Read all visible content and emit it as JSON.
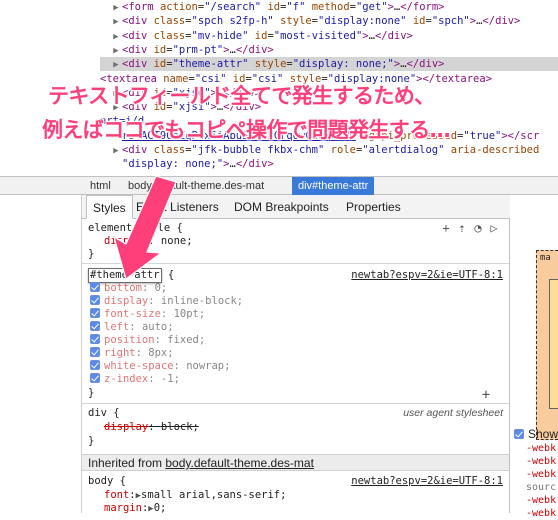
{
  "dom_tree": [
    {
      "parts": [
        [
          "tri",
          "▶"
        ],
        [
          "tag",
          "<form "
        ],
        [
          "attr",
          "action"
        ],
        [
          "txt",
          "="
        ],
        [
          "val",
          "\"/search\""
        ],
        [
          "txt",
          " "
        ],
        [
          "attr",
          "id"
        ],
        [
          "txt",
          "="
        ],
        [
          "val",
          "\"f\""
        ],
        [
          "txt",
          " "
        ],
        [
          "attr",
          "method"
        ],
        [
          "txt",
          "="
        ],
        [
          "val",
          "\"get\""
        ],
        [
          "tag",
          ">"
        ],
        [
          "txt",
          "…"
        ],
        [
          "tag",
          "</form>"
        ]
      ]
    },
    {
      "parts": [
        [
          "tri",
          "▶"
        ],
        [
          "tag",
          "<div "
        ],
        [
          "attr",
          "class"
        ],
        [
          "txt",
          "="
        ],
        [
          "val",
          "\"spch s2fp-h\""
        ],
        [
          "txt",
          " "
        ],
        [
          "attr",
          "style"
        ],
        [
          "txt",
          "="
        ],
        [
          "val",
          "\"display:none\""
        ],
        [
          "txt",
          " "
        ],
        [
          "attr",
          "id"
        ],
        [
          "txt",
          "="
        ],
        [
          "val",
          "\"spch\""
        ],
        [
          "tag",
          ">"
        ],
        [
          "txt",
          "…"
        ],
        [
          "tag",
          "</div>"
        ]
      ]
    },
    {
      "parts": [
        [
          "tri",
          "▶"
        ],
        [
          "tag",
          "<div "
        ],
        [
          "attr",
          "class"
        ],
        [
          "txt",
          "="
        ],
        [
          "val",
          "\"mv-hide\""
        ],
        [
          "txt",
          " "
        ],
        [
          "attr",
          "id"
        ],
        [
          "txt",
          "="
        ],
        [
          "val",
          "\"most-visited\""
        ],
        [
          "tag",
          ">"
        ],
        [
          "txt",
          "…"
        ],
        [
          "tag",
          "</div>"
        ]
      ]
    },
    {
      "parts": [
        [
          "tri",
          "▶"
        ],
        [
          "tag",
          "<div "
        ],
        [
          "attr",
          "id"
        ],
        [
          "txt",
          "="
        ],
        [
          "val",
          "\"prm-pt\""
        ],
        [
          "tag",
          ">"
        ],
        [
          "txt",
          "…"
        ],
        [
          "tag",
          "</div>"
        ]
      ]
    },
    {
      "parts": [
        [
          "tri",
          "▶"
        ],
        [
          "tag",
          "<div "
        ],
        [
          "attr",
          "id"
        ],
        [
          "txt",
          "="
        ],
        [
          "val",
          "\"theme-attr\""
        ],
        [
          "txt",
          " "
        ],
        [
          "attr",
          "style"
        ],
        [
          "txt",
          "="
        ],
        [
          "val",
          "\"display: none;\""
        ],
        [
          "tag",
          ">"
        ],
        [
          "txt",
          "…"
        ],
        [
          "tag",
          "</div>"
        ]
      ]
    },
    {
      "parts": [
        [
          "tag",
          "<textarea "
        ],
        [
          "attr",
          "name"
        ],
        [
          "txt",
          "="
        ],
        [
          "val",
          "\"csi\""
        ],
        [
          "txt",
          " "
        ],
        [
          "attr",
          "id"
        ],
        [
          "txt",
          "="
        ],
        [
          "val",
          "\"csi\""
        ],
        [
          "txt",
          " "
        ],
        [
          "attr",
          "style"
        ],
        [
          "txt",
          "="
        ],
        [
          "val",
          "\"display:none\""
        ],
        [
          "tag",
          ">"
        ],
        [
          "tag",
          "</textarea>"
        ]
      ]
    },
    {
      "parts": [
        [
          "tri",
          "▶"
        ],
        [
          "tag",
          "<div "
        ],
        [
          "attr",
          "id"
        ],
        [
          "txt",
          "="
        ],
        [
          "val",
          "\"xjsd\""
        ],
        [
          "tag",
          ">"
        ],
        [
          "txt",
          "…"
        ],
        [
          "tag",
          "</div>"
        ]
      ]
    },
    {
      "parts": [
        [
          "tri",
          "▶"
        ],
        [
          "tag",
          "<div "
        ],
        [
          "attr",
          "id"
        ],
        [
          "txt",
          "="
        ],
        [
          "val",
          "\"xjsi\""
        ],
        [
          "tag",
          ">"
        ],
        [
          "txt",
          "…"
        ],
        [
          "tag",
          "</div>"
        ]
      ]
    },
    {
      "parts": [
        [
          "txt",
          "                                                "
        ],
        [
          "val",
          "art=j/d"
        ]
      ]
    },
    {
      "parts": [
        [
          "link",
          "rs=ACT90oEqPtx6iAbuSdMT5CrqowCau3FlPw"
        ],
        [
          "txt",
          "\" "
        ],
        [
          "attr",
          "gapi_processed"
        ],
        [
          "txt",
          "="
        ],
        [
          "val",
          "\"true\""
        ],
        [
          "tag",
          "></scr"
        ]
      ]
    },
    {
      "parts": [
        [
          "tri",
          "▶"
        ],
        [
          "tag",
          "<div "
        ],
        [
          "attr",
          "class"
        ],
        [
          "txt",
          "="
        ],
        [
          "val",
          "\"jfk-bubble fkbx-chm\""
        ],
        [
          "txt",
          " "
        ],
        [
          "attr",
          "role"
        ],
        [
          "txt",
          "="
        ],
        [
          "val",
          "\"alertdialog\""
        ],
        [
          "txt",
          " "
        ],
        [
          "attr",
          "aria-described"
        ]
      ]
    },
    {
      "parts": [
        [
          "val",
          "\"display: none;\""
        ],
        [
          "tag",
          ">"
        ],
        [
          "txt",
          "…"
        ],
        [
          "tag",
          "</div>"
        ]
      ]
    }
  ],
  "annotation": {
    "line1": "テキストフィールド全てで発生するため、",
    "line2": "例えばココでもコピペ操作で問題発生する…"
  },
  "breadcrumb": [
    "html",
    "body.default-theme.des-mat",
    "div#theme-attr"
  ],
  "sidebar_tabs": [
    "Styles",
    "Event Listeners",
    "DOM Breakpoints",
    "Properties"
  ],
  "styles": {
    "element_style": {
      "selector": "element.style {",
      "prop": "display",
      "value": "none;",
      "close": "}"
    },
    "theme_rule": {
      "selector": "#theme-attr",
      "brace": " {",
      "source": "newtab?espv=2&ie=UTF-8:1",
      "props": [
        {
          "name": "bottom",
          "value": "0;"
        },
        {
          "name": "display",
          "value": "inline-block;"
        },
        {
          "name": "font-size",
          "value": "10pt;"
        },
        {
          "name": "left",
          "value": "auto;"
        },
        {
          "name": "position",
          "value": "fixed;"
        },
        {
          "name": "right",
          "value": "8px;"
        },
        {
          "name": "white-space",
          "value": "nowrap;"
        },
        {
          "name": "z-index",
          "value": "-1;"
        }
      ],
      "close": "}"
    },
    "ua_rule": {
      "selector": "div {",
      "source": "user agent stylesheet",
      "prop": "display",
      "value": "block;",
      "close": "}"
    },
    "inherited_label": "Inherited from ",
    "inherited_link": "body.default-theme.des-mat",
    "body_rule": {
      "selector": "body {",
      "source": "newtab?espv=2&ie=UTF-8:1",
      "props": [
        {
          "name": "font",
          "value": "small arial,sans-serif;"
        },
        {
          "name": "margin",
          "value": "0;"
        }
      ]
    }
  },
  "right_panel": {
    "box_label": "ma",
    "show_label": "Show",
    "lines": [
      "-webk",
      "-webk",
      "-webk",
      "sourc",
      "-webk",
      "-webk"
    ]
  },
  "colors": {
    "annotation": "#ff3f7a",
    "selected_crumb": "#3879d9"
  }
}
